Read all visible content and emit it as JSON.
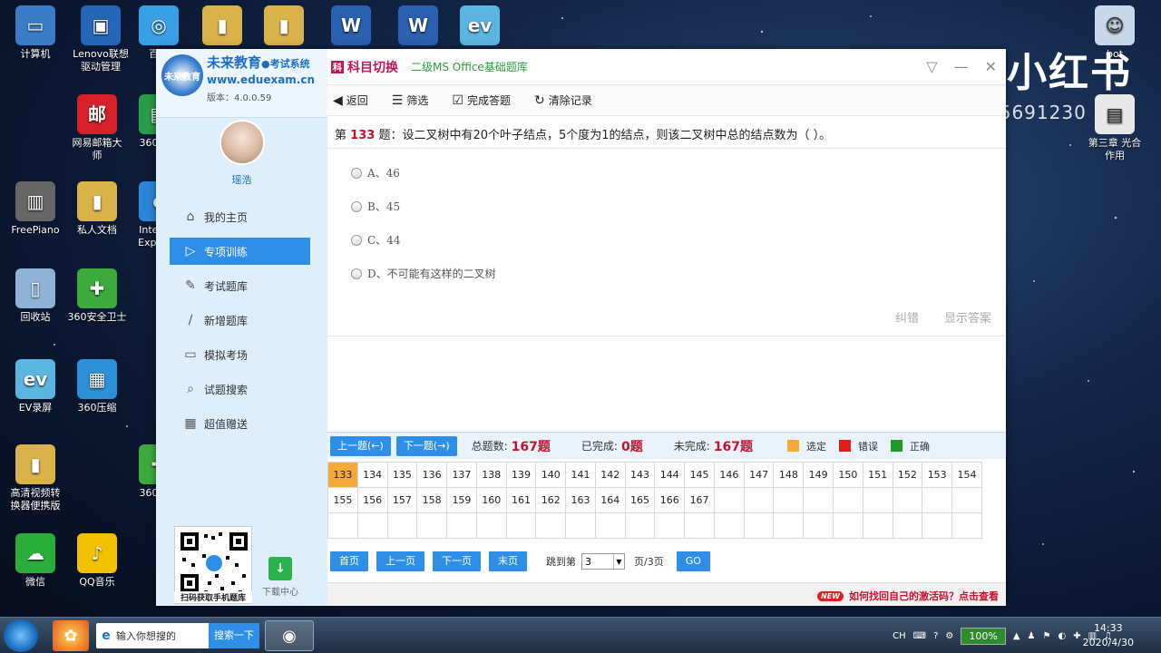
{
  "desktop": {
    "icons_left": [
      {
        "label": "计算机",
        "color": "#3b7cc7",
        "glyph": "▭"
      },
      {
        "label": "Lenovo联想\n驱动管理",
        "color": "#2566b8",
        "glyph": "▣"
      },
      {
        "label": "百度",
        "color": "#3aa0e6",
        "glyph": "◎"
      },
      {
        "label": "网易邮箱大\n师",
        "color": "#d8202a",
        "glyph": "邮"
      },
      {
        "label": "360软件",
        "color": "#2a9d4a",
        "glyph": "▤"
      },
      {
        "label": "FreePiano",
        "color": "#666",
        "glyph": "▥"
      },
      {
        "label": "私人文档",
        "color": "#d9b24a",
        "glyph": "▮"
      },
      {
        "label": "Internet\nExplorer",
        "color": "#2e86d9",
        "glyph": "e"
      },
      {
        "label": "回收站",
        "color": "#8fb3d6",
        "glyph": "▯"
      },
      {
        "label": "360安全卫士",
        "color": "#3daa3d",
        "glyph": "✚"
      },
      {
        "label": "EV录屏",
        "color": "#5ab6e0",
        "glyph": "ev"
      },
      {
        "label": "360压缩",
        "color": "#2d8fd6",
        "glyph": "▦"
      },
      {
        "label": "高清视频转\n换器便携版",
        "color": "#d9b24a",
        "glyph": "▮"
      },
      {
        "label": "360安全",
        "color": "#3daa3d",
        "glyph": "✚"
      },
      {
        "label": "微信",
        "color": "#2aae3a",
        "glyph": "☁"
      },
      {
        "label": "QQ音乐",
        "color": "#f2c200",
        "glyph": "♪"
      }
    ],
    "icons_top": [
      {
        "label": "",
        "color": "#d9b24a",
        "glyph": "▮"
      },
      {
        "label": "",
        "color": "#d9b24a",
        "glyph": "▮"
      },
      {
        "label": "",
        "color": "#2b5fb0",
        "glyph": "W"
      },
      {
        "label": "",
        "color": "#2b5fb0",
        "glyph": "W"
      },
      {
        "label": "",
        "color": "#5ab6e0",
        "glyph": "ev"
      }
    ],
    "icons_right": [
      {
        "label": "bot",
        "color": "#c8d8ea",
        "glyph": "☺"
      },
      {
        "label": "第三章 光合\n作用",
        "color": "#e8e8e8",
        "glyph": "▤"
      }
    ],
    "brand_text": "小红书",
    "watermark_text": "小红书号:5691230"
  },
  "sidebar": {
    "logo_badge": "未来教育",
    "brand_name": "未来教育",
    "brand_suffix": "●考试系统",
    "brand_url": "www.eduexam.cn",
    "version": "版本：4.0.0.59",
    "user_name": "瑶浩",
    "nav": [
      {
        "label": "我的主页",
        "icon": "home-icon",
        "glyph": "⌂",
        "active": false
      },
      {
        "label": "专项训练",
        "icon": "play-icon",
        "glyph": "▷",
        "active": true
      },
      {
        "label": "考试题库",
        "icon": "edit-icon",
        "glyph": "✎",
        "active": false
      },
      {
        "label": "新增题库",
        "icon": "pen-icon",
        "glyph": "∕",
        "active": false
      },
      {
        "label": "模拟考场",
        "icon": "monitor-icon",
        "glyph": "▭",
        "active": false
      },
      {
        "label": "试题搜索",
        "icon": "search-icon",
        "glyph": "⌕",
        "active": false
      },
      {
        "label": "超值赠送",
        "icon": "gift-icon",
        "glyph": "▦",
        "active": false
      }
    ],
    "qr_caption": "扫码获取手机题库",
    "download_label": "下载中心"
  },
  "titlebar": {
    "switch_label": "科目切换",
    "subject": "二级MS Office基础题库"
  },
  "toolbar": {
    "back": "返回",
    "filter": "筛选",
    "finish": "完成答题",
    "clear": "清除记录"
  },
  "question": {
    "prefix": "第",
    "number": "133",
    "text": "题：设二叉树中有20个叶子结点，5个度为1的结点，则该二叉树中总的结点数为（ ）。",
    "options": [
      "A、46",
      "B、45",
      "C、44",
      "D、不可能有这样的二叉树"
    ],
    "report_error": "纠错",
    "show_answer": "显示答案"
  },
  "status": {
    "prev": "上一题(←)",
    "next": "下一题(→)",
    "total_label": "总题数:",
    "total_value": "167题",
    "done_label": "已完成:",
    "done_value": "0题",
    "undone_label": "未完成:",
    "undone_value": "167题",
    "legend": [
      {
        "label": "选定",
        "color": "#f4a93b"
      },
      {
        "label": "错误",
        "color": "#e01b1b"
      },
      {
        "label": "正确",
        "color": "#1f9a2a"
      }
    ]
  },
  "grid": {
    "row1": [
      "133",
      "134",
      "135",
      "136",
      "137",
      "138",
      "139",
      "140",
      "141",
      "142",
      "143",
      "144",
      "145",
      "146",
      "147",
      "148",
      "149",
      "150",
      "151",
      "152",
      "153",
      "154"
    ],
    "row2": [
      "155",
      "156",
      "157",
      "158",
      "159",
      "160",
      "161",
      "162",
      "163",
      "164",
      "165",
      "166",
      "167",
      "",
      "",
      "",
      "",
      "",
      "",
      "",
      "",
      ""
    ],
    "selected": "133"
  },
  "pager": {
    "first": "首页",
    "prev": "上一页",
    "next": "下一页",
    "last": "末页",
    "jump_label": "跳到第",
    "page_value": "3",
    "total": "页/3页",
    "go": "GO"
  },
  "footer": {
    "badge": "NEW",
    "link": "如何找回自己的激活码？点击查看"
  },
  "taskbar": {
    "search_placeholder": "输入你想搜的",
    "search_button": "搜索一下",
    "ime": "CH",
    "battery": "100%",
    "time": "14:33",
    "date": "2020/4/30"
  }
}
